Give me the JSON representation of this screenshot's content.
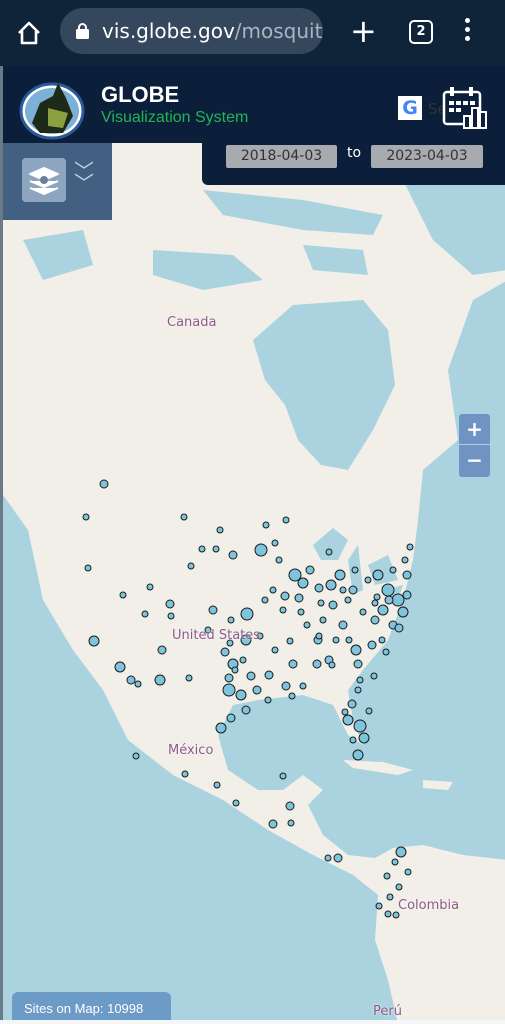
{
  "browser": {
    "url_host": "vis.globe.gov",
    "url_path": "/mosquit",
    "tab_count": "2",
    "icons": [
      "home-icon",
      "lock-icon",
      "plus-icon",
      "tabs-icon",
      "menu-icon"
    ]
  },
  "header": {
    "title": "GLOBE",
    "subtitle": "Visualization System",
    "search_label": "Search",
    "google_icon": "G"
  },
  "dates": {
    "start": "2018-04-03",
    "separator": "to",
    "end": "2023-04-03"
  },
  "map": {
    "labels": {
      "canada": "Canada",
      "usa": "United States",
      "mexico": "México",
      "colombia": "Colombia",
      "peru": "Perú"
    },
    "zoom_in": "+",
    "zoom_out": "−",
    "sites_text": "Sites on Map: 10998",
    "colors": {
      "water": "#aad3df",
      "land": "#f2efe9",
      "marker": "#7ec4dc",
      "marker_stroke": "#1a1a1a",
      "label": "#8c5a88"
    }
  }
}
